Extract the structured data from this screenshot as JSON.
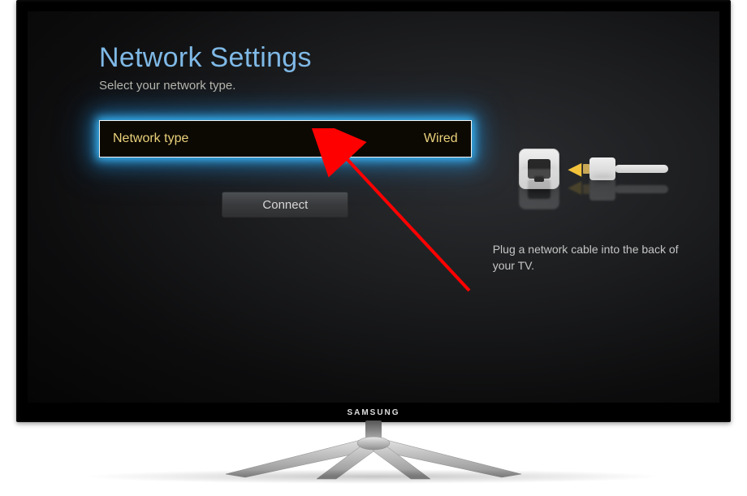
{
  "brand": "SAMSUNG",
  "header": {
    "title": "Network Settings",
    "subtitle": "Select your network type."
  },
  "network_type": {
    "label": "Network type",
    "value": "Wired"
  },
  "connect_label": "Connect",
  "help_text": "Plug a network cable into the back of your TV."
}
